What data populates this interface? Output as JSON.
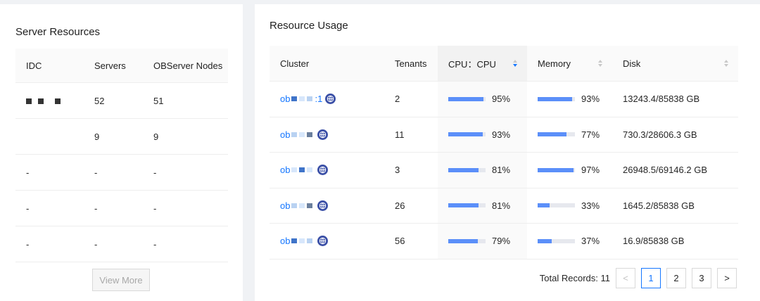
{
  "server_resources": {
    "title": "Server Resources",
    "columns": [
      "IDC",
      "Servers",
      "OBServer Nodes"
    ],
    "rows": [
      {
        "idc": "",
        "servers": "52",
        "nodes": "51"
      },
      {
        "idc": "",
        "servers": "9",
        "nodes": "9"
      },
      {
        "idc": "-",
        "servers": "-",
        "nodes": "-"
      },
      {
        "idc": "-",
        "servers": "-",
        "nodes": "-"
      },
      {
        "idc": "-",
        "servers": "-",
        "nodes": "-"
      }
    ],
    "view_more_label": "View More"
  },
  "resource_usage": {
    "title": "Resource Usage",
    "columns": {
      "cluster": "Cluster",
      "tenants": "Tenants",
      "cpu": "CPU：CPU",
      "memory": "Memory",
      "disk": "Disk"
    },
    "rows": [
      {
        "cluster_prefix": "ob",
        "cluster_suffix": ":1",
        "tenants": "2",
        "cpu_pct": 95,
        "cpu_label": "95%",
        "mem_pct": 93,
        "mem_label": "93%",
        "disk": "13243.4/85838 GB"
      },
      {
        "cluster_prefix": "ob",
        "cluster_suffix": "",
        "tenants": "11",
        "cpu_pct": 93,
        "cpu_label": "93%",
        "mem_pct": 77,
        "mem_label": "77%",
        "disk": "730.3/28606.3 GB"
      },
      {
        "cluster_prefix": "ob",
        "cluster_suffix": "",
        "tenants": "3",
        "cpu_pct": 81,
        "cpu_label": "81%",
        "mem_pct": 97,
        "mem_label": "97%",
        "disk": "26948.5/69146.2 GB"
      },
      {
        "cluster_prefix": "ob",
        "cluster_suffix": "",
        "tenants": "26",
        "cpu_pct": 81,
        "cpu_label": "81%",
        "mem_pct": 33,
        "mem_label": "33%",
        "disk": "1645.2/85838 GB"
      },
      {
        "cluster_prefix": "ob",
        "cluster_suffix": "",
        "tenants": "56",
        "cpu_pct": 79,
        "cpu_label": "79%",
        "mem_pct": 37,
        "mem_label": "37%",
        "disk": "16.9/85838 GB"
      }
    ],
    "pagination": {
      "total_label": "Total Records: 11",
      "prev": "<",
      "next": ">",
      "pages": [
        "1",
        "2",
        "3"
      ],
      "current": "1"
    }
  },
  "icons": {
    "cluster_type": "globe-icon",
    "sort": "sort-icon",
    "prev": "chevron-left-icon",
    "next": "chevron-right-icon"
  },
  "colors": {
    "accent": "#1677ff",
    "bar_fill": "#5b8ff9",
    "bar_track": "#e6e8ee",
    "globe": "#3a4fa6"
  }
}
